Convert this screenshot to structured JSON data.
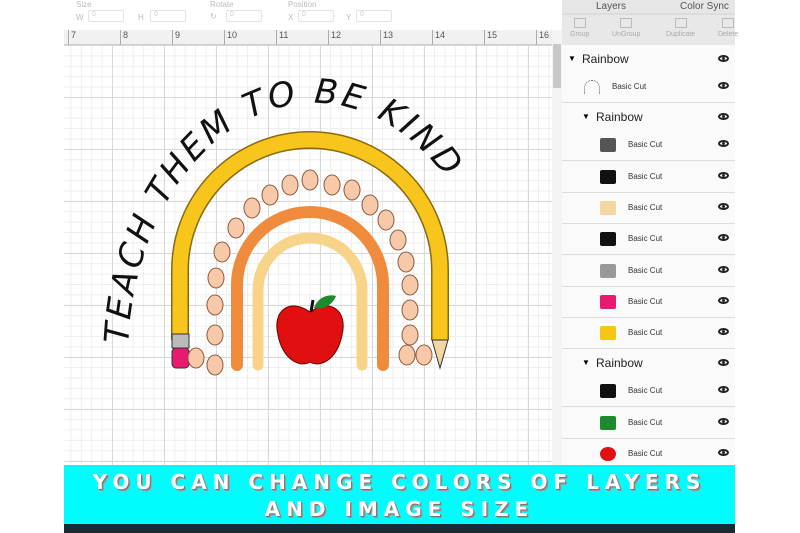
{
  "toolbar": {
    "size_label": "Size",
    "w_label": "W",
    "h_label": "H",
    "w_value": "0",
    "h_value": "0",
    "rotate_label": "Rotate",
    "rotate_value": "0",
    "position_label": "Position",
    "x_label": "X",
    "y_label": "Y",
    "x_value": "0",
    "y_value": "0"
  },
  "ruler": {
    "ticks": [
      "7",
      "8",
      "9",
      "10",
      "11",
      "12",
      "13",
      "14",
      "15",
      "16"
    ]
  },
  "artwork": {
    "text": "TEACH THEM TO BE KIND"
  },
  "panel": {
    "tabs": [
      "Layers",
      "Color Sync"
    ],
    "actions": [
      "Group",
      "UnGroup",
      "Duplicate",
      "Delete"
    ],
    "layers": [
      {
        "type": "group",
        "label": "Rainbow"
      },
      {
        "type": "layer",
        "label": "Basic Cut",
        "thumb": "text-arc"
      },
      {
        "type": "group",
        "label": "Rainbow"
      },
      {
        "type": "layer",
        "label": "Basic Cut",
        "thumb": "pencil-tip",
        "color": "#555555"
      },
      {
        "type": "layer",
        "label": "Basic Cut",
        "thumb": "pencil-point",
        "color": "#111111"
      },
      {
        "type": "layer",
        "label": "Basic Cut",
        "thumb": "pencil-wood",
        "color": "#f3d6a0"
      },
      {
        "type": "layer",
        "label": "Basic Cut",
        "thumb": "stripes",
        "color": "#111111"
      },
      {
        "type": "layer",
        "label": "Basic Cut",
        "thumb": "ferrule",
        "color": "#999999"
      },
      {
        "type": "layer",
        "label": "Basic Cut",
        "thumb": "eraser",
        "color": "#e8196e"
      },
      {
        "type": "layer",
        "label": "Basic Cut",
        "thumb": "arc",
        "color": "#f5c518"
      },
      {
        "type": "group",
        "label": "Rainbow"
      },
      {
        "type": "layer",
        "label": "Basic Cut",
        "thumb": "stem",
        "color": "#111111"
      },
      {
        "type": "layer",
        "label": "Basic Cut",
        "thumb": "leaf",
        "color": "#1e8a2e"
      },
      {
        "type": "layer",
        "label": "Basic Cut",
        "thumb": "apple",
        "color": "#e01010"
      }
    ]
  },
  "banner": {
    "line1": "YOU CAN CHANGE COLORS OF LAYERS",
    "line2": "AND IMAGE SIZE"
  },
  "colors": {
    "banner": "#00fdfd",
    "pencil": "#f7c51c",
    "orange": "#f08a3c",
    "light": "#f7d48a",
    "dots": "#f8c9a8",
    "apple": "#e01010"
  }
}
